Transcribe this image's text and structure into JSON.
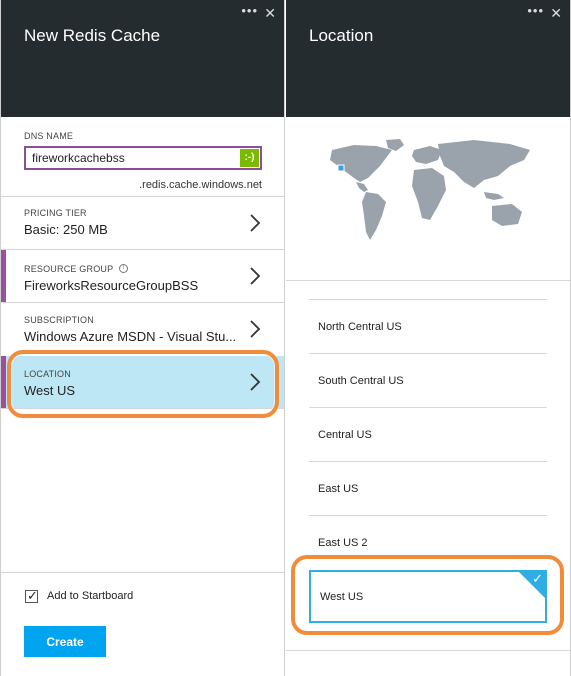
{
  "left_blade": {
    "title": "New Redis Cache",
    "controls": {
      "more": "•••",
      "close": "✕"
    },
    "dns": {
      "label": "DNS NAME",
      "value": "fireworkcachebss",
      "valid_icon": ":-)",
      "suffix": ".redis.cache.windows.net"
    },
    "pricing": {
      "label": "PRICING TIER",
      "value": "Basic: 250 MB"
    },
    "resource_group": {
      "label": "RESOURCE GROUP",
      "info_icon": "i",
      "value": "FireworksResourceGroupBSS"
    },
    "subscription": {
      "label": "SUBSCRIPTION",
      "value": "Windows Azure MSDN - Visual Stu..."
    },
    "location": {
      "label": "LOCATION",
      "value": "West US"
    },
    "startboard": {
      "label": "Add to Startboard",
      "checked": true
    },
    "create_label": "Create"
  },
  "right_blade": {
    "title": "Location",
    "controls": {
      "more": "•••",
      "close": "✕"
    },
    "locations": [
      {
        "label": "North Central US"
      },
      {
        "label": "South Central US"
      },
      {
        "label": "Central US"
      },
      {
        "label": "East US"
      },
      {
        "label": "East US 2"
      },
      {
        "label": "West US",
        "selected": true
      }
    ],
    "check_mark": "✓"
  },
  "colors": {
    "header_bg": "#252c30",
    "accent_purple": "#9b4f9e",
    "selected_bg": "#bde7f4",
    "callout_orange": "#f08c3a",
    "create_blue": "#00a4ef",
    "valid_green": "#7bba00",
    "map_land": "#9aa3ab",
    "selected_border": "#2eaee3"
  }
}
